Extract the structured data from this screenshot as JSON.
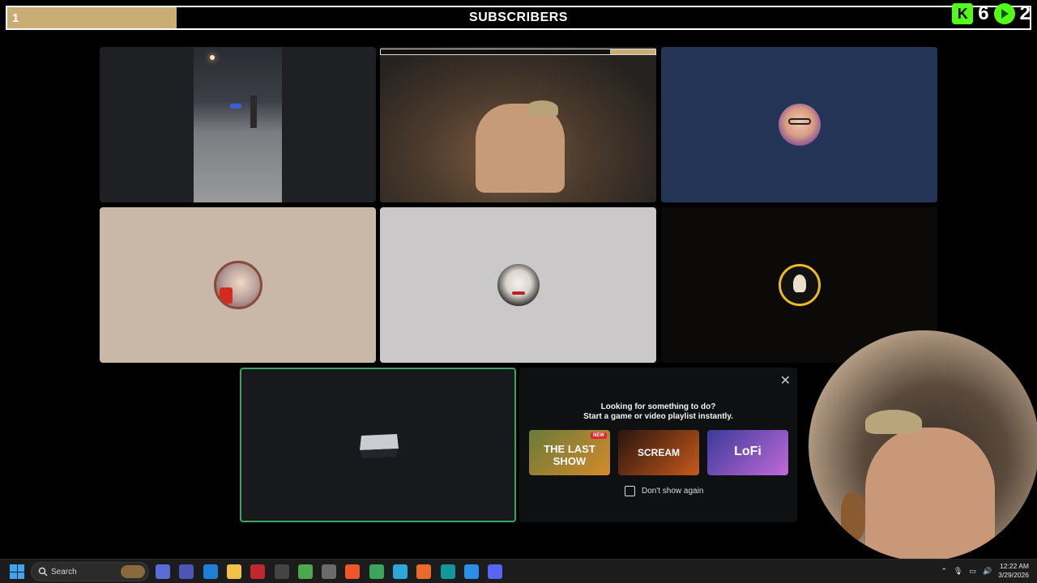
{
  "subscribers_bar": {
    "count": "1",
    "title": "SUBSCRIBERS",
    "progress_fraction": 0.166,
    "kick_count": "6",
    "rumble_count": "2",
    "fill_color": "#c9ad72"
  },
  "tiles": [
    {
      "name": "tile-street-video",
      "bg": "#1f2023"
    },
    {
      "name": "tile-room-video",
      "bg": "#2b2520"
    },
    {
      "name": "tile-avatar-glasses",
      "bg": "#233457",
      "avatar": "avatar-glasses-man"
    },
    {
      "name": "tile-avatar-mario",
      "bg": "#c9b7a7",
      "avatar": "avatar-mario"
    },
    {
      "name": "tile-avatar-joker",
      "bg": "#cac8c8",
      "avatar": "avatar-joker"
    },
    {
      "name": "tile-avatar-gold-logo",
      "bg": "#0b0a08",
      "avatar": "avatar-gold-logo"
    }
  ],
  "activity": {
    "question_line1": "Looking for something to do?",
    "question_line2": "Start a game or video playlist instantly.",
    "new_tag": "NEW",
    "games": [
      {
        "label": "THE LAST SHOW",
        "color1": "#6a7a3a",
        "color2": "#d48b2a"
      },
      {
        "label": "SCREAM",
        "color1": "#2a1410",
        "color2": "#c65a1a"
      },
      {
        "label": "LoFi",
        "color1": "#3a3a9a",
        "color2": "#c06ad8"
      }
    ],
    "dont_show": "Don't show again",
    "close_icon": "close-icon"
  },
  "taskbar": {
    "search_label": "Search",
    "time": "12:22 AM",
    "date": "3/29/2026",
    "apps": [
      {
        "name": "copilot-icon",
        "color": "#5a6bd8"
      },
      {
        "name": "teams-icon",
        "color": "#4b56b5"
      },
      {
        "name": "remote-icon",
        "color": "#1f7fd6"
      },
      {
        "name": "file-explorer-icon",
        "color": "#f2c14a"
      },
      {
        "name": "news-icon",
        "color": "#c0282d"
      },
      {
        "name": "obs-icon",
        "color": "#444444"
      },
      {
        "name": "vpn-icon",
        "color": "#4ca84c"
      },
      {
        "name": "capture-icon",
        "color": "#6b6b6b"
      },
      {
        "name": "brave-icon",
        "color": "#f0552b"
      },
      {
        "name": "chrome-icon",
        "color": "#3ba55d"
      },
      {
        "name": "edge-icon",
        "color": "#2fa6d9"
      },
      {
        "name": "firefox-icon",
        "color": "#e96a2a"
      },
      {
        "name": "arduino-icon",
        "color": "#12979d"
      },
      {
        "name": "vscode-icon",
        "color": "#2b8fe8"
      },
      {
        "name": "discord-icon",
        "color": "#5865f2"
      }
    ]
  }
}
